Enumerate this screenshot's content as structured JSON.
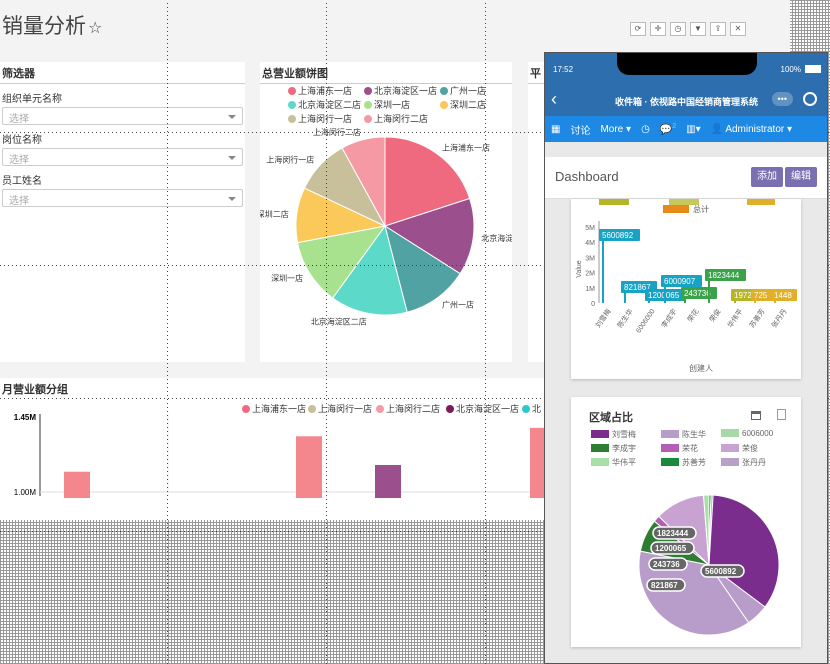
{
  "page": {
    "title": "销量分析",
    "star": "☆"
  },
  "toolbar": [
    "refresh-icon",
    "plus-icon",
    "clock-icon",
    "filter-icon",
    "share-icon",
    "delete-icon"
  ],
  "filter": {
    "title": "筛选器",
    "fields": [
      {
        "label": "组织单元名称",
        "placeholder": "选择"
      },
      {
        "label": "岗位名称",
        "placeholder": "选择"
      },
      {
        "label": "员工姓名",
        "placeholder": "选择"
      }
    ]
  },
  "pie_panel": {
    "title": "总营业额饼图"
  },
  "side_panel": {
    "title": "平"
  },
  "monthly_panel": {
    "title": "月营业额分组"
  },
  "chart_data": [
    {
      "type": "pie",
      "title": "总营业额饼图",
      "legend": [
        "上海浦东一店",
        "北京海淀区一店",
        "广州一店",
        "北京海淀区二店",
        "深圳一店",
        "深圳二店",
        "上海闵行一店",
        "上海闵行二店"
      ],
      "series": [
        {
          "values": [
            20,
            14,
            12,
            14,
            12,
            10,
            10,
            8
          ]
        }
      ],
      "slice_labels": [
        "上海浦东一店",
        "北京海淀区一店",
        "广州一店",
        "北京海淀区二店",
        "深圳一店",
        "深圳二店",
        "上海闵行一店",
        "上海闵行二店"
      ],
      "colors": [
        "#ef6a7e",
        "#9b4f8c",
        "#51a3a3",
        "#5cd9c9",
        "#a9e28f",
        "#fbc95a",
        "#c8c09a",
        "#f59aa4"
      ]
    },
    {
      "type": "bar",
      "title": "月营业额分组",
      "legend": [
        "上海浦东一店",
        "上海闵行一店",
        "上海闵行二店",
        "北京海淀区一店",
        "北"
      ],
      "ticks": [
        "1.45M",
        "1.00M"
      ],
      "ylim": [
        0.9,
        1.45
      ],
      "bars": [
        {
          "series": "上海闵行二店",
          "value": 1.12,
          "color": "#f4868e",
          "slot": 0
        },
        {
          "series": "上海闵行二店",
          "value": 1.33,
          "color": "#f4868e",
          "slot": 1
        },
        {
          "series": "北京海淀区一店",
          "value": 1.16,
          "color": "#9b4f8c",
          "slot": 2
        },
        {
          "series": "上海闵行二店",
          "value": 1.38,
          "color": "#f4868e",
          "slot": 3
        }
      ]
    },
    {
      "type": "bar",
      "title": "",
      "ylabel": "Value",
      "xlabel": "创建人",
      "yticks": [
        "0",
        "1M",
        "2M",
        "3M",
        "4M",
        "5M"
      ],
      "categories": [
        "刘雪梅",
        "陈生华",
        "6006000",
        "李成宇",
        "荣花",
        "荣俊",
        "华伟平",
        "苏善芳",
        "张丹丹"
      ],
      "labels": [
        {
          "text": "5600892",
          "color": "#18a3c4"
        },
        {
          "text": "821867",
          "color": "#18a3c4"
        },
        {
          "text": "1200065",
          "color": "#18a3c4"
        },
        {
          "text": "6000907",
          "color": "#18a3c4"
        },
        {
          "text": "243736",
          "color": "#3aa34a"
        },
        {
          "text": "1823444",
          "color": "#3aa34a"
        },
        {
          "text": "197216",
          "color": "#b5b52a"
        },
        {
          "text": "725",
          "color": "#e0b02a"
        },
        {
          "text": "1448",
          "color": "#e0b02a"
        }
      ],
      "legend_total": "总计"
    },
    {
      "type": "pie",
      "title": "区域占比",
      "legend": [
        "刘雪梅",
        "陈生华",
        "6006000",
        "李成宇",
        "荣花",
        "荣俊",
        "华伟平",
        "苏善芳",
        "张丹丹"
      ],
      "legend_colors": [
        "#7b2d8e",
        "#b89cc9",
        "#a8d8a8",
        "#2e7d32",
        "#b45fb6",
        "#c8a2d0",
        "#a8e0a8",
        "#1a8a3a",
        "#b9a0c8"
      ],
      "series": [
        {
          "values": [
            5600892,
            821867,
            6000907,
            1200065,
            243736,
            1823444,
            197216,
            725,
            1448
          ]
        }
      ],
      "value_labels": [
        "5600892",
        "821867",
        "1200065",
        "243736",
        "1823444"
      ]
    }
  ],
  "phone": {
    "time": "17:52",
    "battery": "100%",
    "nav_title": "收件箱 · 依视路中国经销商管理系统",
    "more_icon": "•••",
    "menu": {
      "discuss": "讨论",
      "more": "More",
      "badge": "2",
      "user": "Administrator"
    },
    "dashboard": "Dashboard",
    "add": "添加",
    "edit": "编辑",
    "pie_title": "区域占比"
  }
}
